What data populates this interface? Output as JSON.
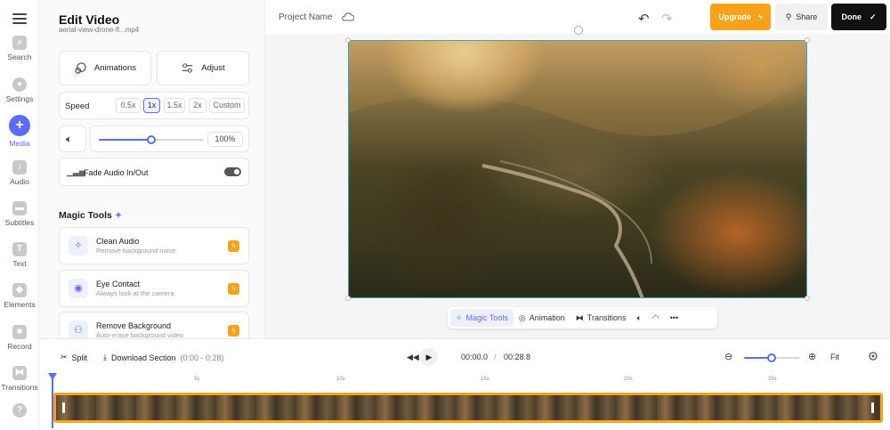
{
  "rail": {
    "items": [
      {
        "label": "Search",
        "icon": "search-icon"
      },
      {
        "label": "Settings",
        "icon": "gear-icon"
      },
      {
        "label": "Media",
        "icon": "plus-icon"
      },
      {
        "label": "Audio",
        "icon": "music-icon"
      },
      {
        "label": "Subtitles",
        "icon": "subtitles-icon"
      },
      {
        "label": "Text",
        "icon": "text-icon"
      },
      {
        "label": "Elements",
        "icon": "elements-icon"
      },
      {
        "label": "Record",
        "icon": "record-icon"
      },
      {
        "label": "Transitions",
        "icon": "transitions-icon"
      }
    ]
  },
  "panel": {
    "title": "Edit Video",
    "filename": "aerial-view-drone-fl...mp4",
    "animations_label": "Animations",
    "adjust_label": "Adjust",
    "speed_label": "Speed",
    "speed_options": [
      "0.5x",
      "1x",
      "1.5x",
      "2x",
      "Custom"
    ],
    "speed_selected": "1x",
    "volume_value": "100%",
    "volume_level": 1.0,
    "fade_label": "Fade Audio In/Out",
    "fade_enabled": false,
    "magic_tools_title": "Magic Tools",
    "tools": [
      {
        "name": "Clean Audio",
        "desc": "Remove background noise",
        "icon": "sparkle-icon"
      },
      {
        "name": "Eye Contact",
        "desc": "Always look at the camera",
        "icon": "eye-icon"
      },
      {
        "name": "Remove Background",
        "desc": "Auto-erase background video",
        "icon": "person-icon"
      }
    ]
  },
  "topbar": {
    "project_name": "Project Name",
    "upgrade_label": "Upgrade",
    "share_label": "Share",
    "done_label": "Done"
  },
  "canvas_toolbar": {
    "magic_tools": "Magic Tools",
    "animation": "Animation",
    "transitions": "Transitions"
  },
  "timeline": {
    "split_label": "Split",
    "download_label": "Download Section",
    "download_range": "(0:00 - 0:28)",
    "current_time": "00:00.0",
    "separator": "/",
    "total_time": "00:28.8",
    "fit_label": "Fit",
    "zoom_level": 0.5,
    "ruler_labels": [
      "5s",
      "10s",
      "15s",
      "20s",
      "25s"
    ]
  },
  "colors": {
    "accent": "#5b6cf9",
    "upgrade": "#f6a21b",
    "done": "#111111",
    "clip_border": "#f6a21b"
  }
}
